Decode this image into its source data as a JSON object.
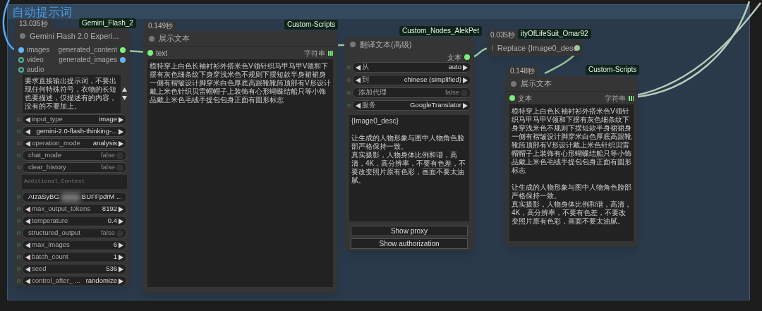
{
  "group": {
    "title": "自动提示词"
  },
  "gemini_node": {
    "time": "13.035秒",
    "source": "Gemini_Flash_2",
    "title": "Gemini Flash 2.0 Experi...",
    "inputs": [
      {
        "label": "images",
        "connected": true,
        "color": "#64b5f6"
      },
      {
        "label": "video",
        "connected": false,
        "color": "#4db6ac"
      },
      {
        "label": "audio",
        "connected": false,
        "color": "#4db6ac"
      }
    ],
    "outputs": [
      {
        "label": "generated_content",
        "color": "#7cf07c"
      },
      {
        "label": "generated_images",
        "color": "#64b5f6"
      }
    ],
    "prompt": "要求直接输出提示词，不要出现任何特殊符号，衣物的长短也要描述，仅描述有的内容，没有的不要加上。",
    "widgets": [
      {
        "kind": "combo",
        "label": "input_type",
        "value": "image"
      },
      {
        "kind": "combo",
        "value": "gemini-2.0-flash-thinking-..."
      },
      {
        "kind": "combo",
        "label": "operation_mode",
        "value": "analysis"
      },
      {
        "kind": "toggle",
        "label": "chat_mode",
        "value": "false"
      },
      {
        "kind": "toggle",
        "label": "clear_history",
        "value": "false"
      }
    ],
    "context_placeholder": "Additional_Context",
    "widgets_2": [
      {
        "kind": "secret",
        "value": "AIzaSyBG",
        "value_end": "BUFFpdrM ..."
      },
      {
        "kind": "combo",
        "label": "max_output_tokens",
        "value": "8192"
      },
      {
        "kind": "combo",
        "label": "temperature",
        "value": "0.4"
      },
      {
        "kind": "toggle",
        "label": "structured_output",
        "value": "false"
      },
      {
        "kind": "combo",
        "label": "max_images",
        "value": "6"
      },
      {
        "kind": "combo",
        "label": "batch_count",
        "value": "1"
      },
      {
        "kind": "combo",
        "label": "seed",
        "value": "536"
      },
      {
        "kind": "combo",
        "label": "control_after_ ...",
        "value": "randomize"
      }
    ]
  },
  "display_node_1": {
    "time": "0.149秒",
    "source": "Custom-Scripts",
    "title": "展示文本",
    "input": "text",
    "type": "字符串",
    "paragraphs": [
      "模特穿上白色长袖衬衫外搭米色V领针织马甲马甲V领和下摆有灰色细条纹下身穿浅米色不规则下摆短款半身裙裙身一侧有褶皱设计脚穿米白色厚底高跟靴靴筒顶部有V形设计戴上米色针织贝雷帽帽子上装饰有心形蝴蝶结船只等小饰品戴上米色毛绒手提包包身正面有圆形标志"
    ]
  },
  "translate_node": {
    "source": "Custom_Nodes_AlekPet",
    "title": "翻译文本(高级)",
    "output": "文本",
    "widgets": [
      {
        "kind": "combo",
        "label": "从",
        "value": "auto"
      },
      {
        "kind": "combo",
        "label": "到",
        "value": "chinese (simplified)"
      },
      {
        "kind": "toggle",
        "label": "添加代理",
        "value": "false"
      },
      {
        "kind": "combo",
        "label": "服务",
        "value": "GoogleTranslator"
      }
    ],
    "paragraphs": [
      "{Image0_desc}",
      "让生成的人物形象与图中人物角色脸部严格保持一致。",
      "真实摄影，人物身体比例和谐，高清，4K，高分辨率，不要有色差，不要改变照片原有色彩，画面不要太油腻。"
    ],
    "buttons": [
      "Show proxy",
      "Show authorization"
    ]
  },
  "replace_node": {
    "time": "0.035秒",
    "source": "ityOfLifeSuit_Omar92",
    "title": "Replace {Image0_desc"
  },
  "display_node_2": {
    "time": "0.148秒",
    "source": "Custom-Scripts",
    "title": "展示文本",
    "input": "文本",
    "type": "字符串",
    "paragraphs": [
      "模特穿上白色长袖衬衫外搭米色V领针织马甲马甲V领和下摆有灰色细条纹下身穿浅米色不规则下摆短款半身裙裙身一侧有褶皱设计脚穿米白色厚底高跟靴靴筒顶部有V形设计戴上米色针织贝雷帽帽子上装饰有心形蝴蝶结船只等小饰品戴上米色毛绒手提包包身正面有圆形标志",
      "让生成的人物形象与图中人物角色脸部严格保持一致。",
      "真实摄影，人物身体比例和谐，高清，4K，高分辨率，不要有色差，不要改变照片原有色彩，画面不要太油腻。"
    ]
  }
}
